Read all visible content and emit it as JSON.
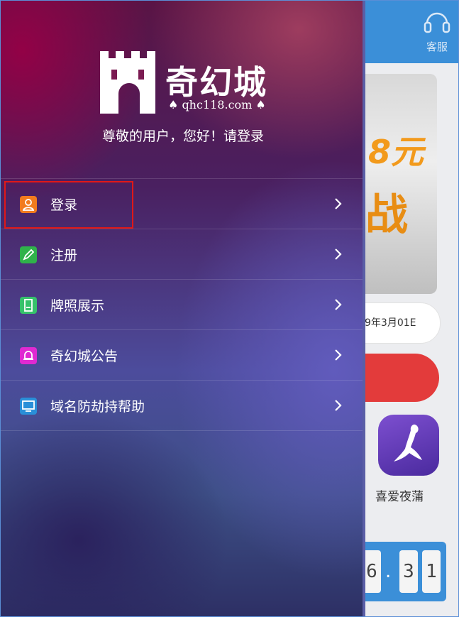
{
  "header": {
    "service_label": "客服"
  },
  "background": {
    "banner_text1": "8元",
    "banner_text2": "战",
    "notice_date": "9年3月01E",
    "app_label": "喜爱夜蒲",
    "counter_digits": [
      "6",
      "3",
      "1"
    ],
    "counter_dot": "."
  },
  "drawer": {
    "logo_title": "奇幻城",
    "logo_domain": "qhc118.com",
    "welcome": "尊敬的用户，您好！请登录",
    "items": [
      {
        "label": "登录",
        "icon": "user-icon",
        "icon_color": "#f27b1e"
      },
      {
        "label": "注册",
        "icon": "pencil-icon",
        "icon_color": "#2fb24a"
      },
      {
        "label": "牌照展示",
        "icon": "license-icon",
        "icon_color": "#36c26b"
      },
      {
        "label": "奇幻城公告",
        "icon": "bell-icon",
        "icon_color": "#e02ad2"
      },
      {
        "label": "域名防劫持帮助",
        "icon": "monitor-icon",
        "icon_color": "#2a8fd8"
      }
    ]
  },
  "colors": {
    "highlight": "#e01818",
    "topbar": "#3b8fd8"
  }
}
